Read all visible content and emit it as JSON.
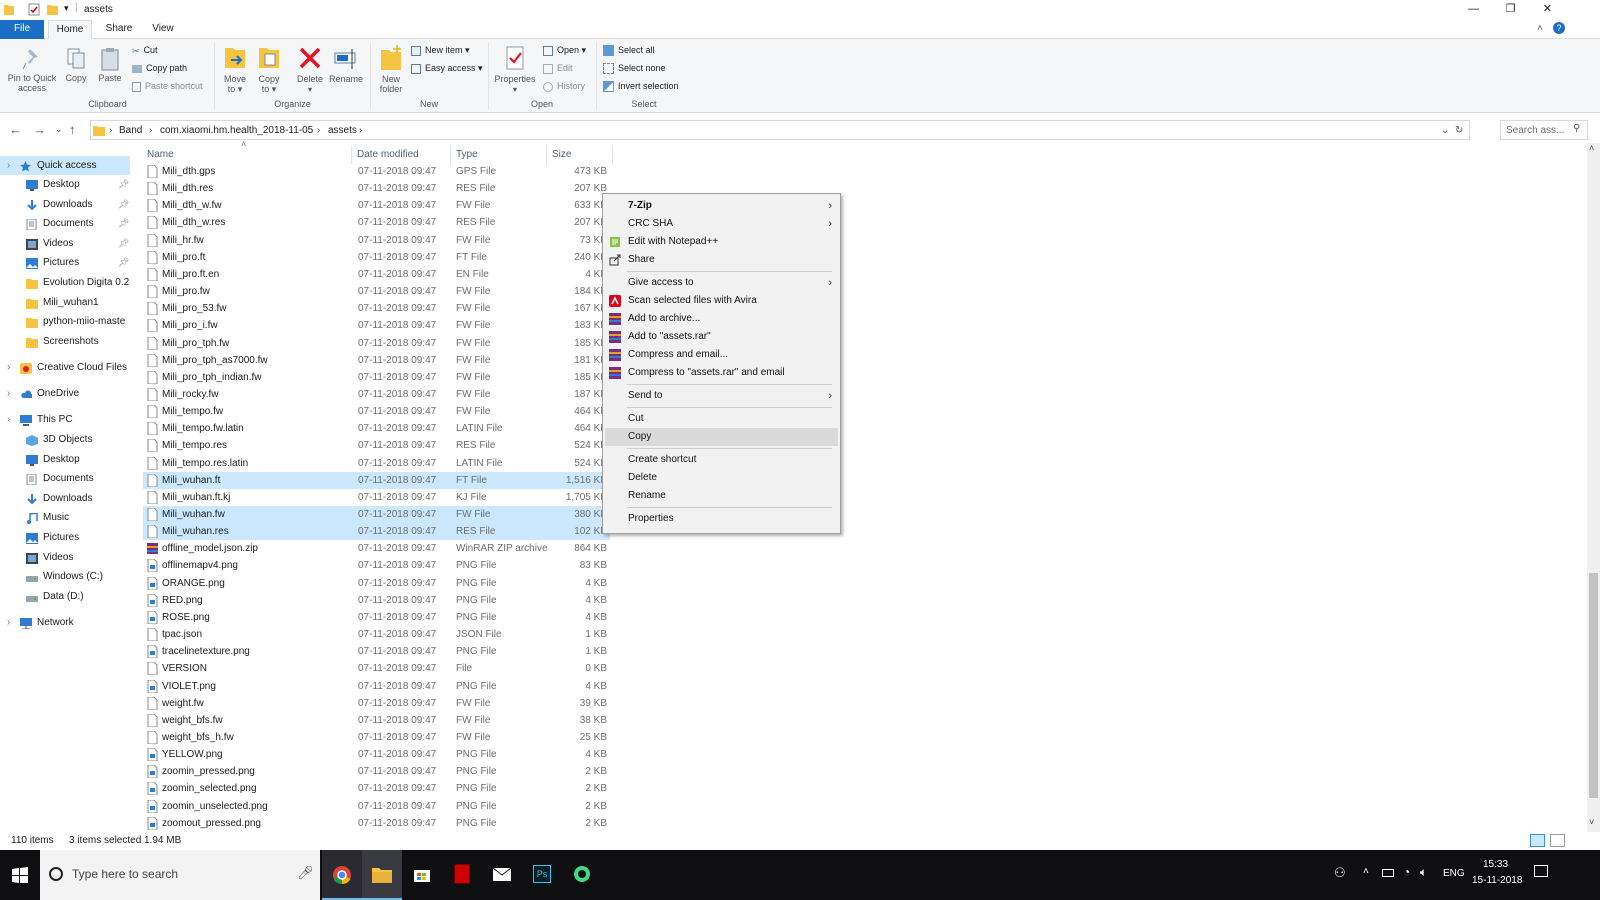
{
  "window": {
    "title": "assets"
  },
  "tabs": [
    {
      "label": "File"
    },
    {
      "label": "Home"
    },
    {
      "label": "Share"
    },
    {
      "label": "View"
    }
  ],
  "ribbon": {
    "clipboard": {
      "group": "Clipboard",
      "pin": "Pin to Quick access",
      "copy": "Copy",
      "paste": "Paste",
      "cut": "Cut",
      "copy_path": "Copy path",
      "paste_shortcut": "Paste shortcut"
    },
    "organize": {
      "group": "Organize",
      "move_to": "Move to ▾",
      "copy_to": "Copy to ▾",
      "delete": "Delete",
      "rename": "Rename"
    },
    "new": {
      "group": "New",
      "new_folder": "New folder",
      "new_item": "New item ▾",
      "easy_access": "Easy access ▾"
    },
    "open": {
      "group": "Open",
      "properties": "Properties",
      "open": "Open ▾",
      "edit": "Edit",
      "history": "History"
    },
    "select": {
      "group": "Select",
      "select_all": "Select all",
      "select_none": "Select none",
      "invert": "Invert selection"
    }
  },
  "address": {
    "crumbs": [
      "Band",
      "com.xiaomi.hm.health_2018-11-05",
      "assets"
    ],
    "search_placeholder": "Search ass..."
  },
  "nav": {
    "quick_access": "Quick access",
    "quick_items": [
      "Desktop",
      "Downloads",
      "Documents",
      "Videos",
      "Pictures",
      "Evolution Digita 0.2",
      "Mili_wuhan1",
      "python-miio-maste",
      "Screenshots"
    ],
    "creative_cloud": "Creative Cloud Files",
    "onedrive": "OneDrive",
    "this_pc": "This PC",
    "pc_items": [
      "3D Objects",
      "Desktop",
      "Documents",
      "Downloads",
      "Music",
      "Pictures",
      "Videos",
      "Windows (C:)",
      "Data (D:)"
    ],
    "network": "Network"
  },
  "columns": {
    "name": "Name",
    "date": "Date modified",
    "type": "Type",
    "size": "Size"
  },
  "files": [
    {
      "name": "Mili_dth.gps",
      "date": "07-11-2018 09:47",
      "type": "GPS File",
      "size": "473 KB"
    },
    {
      "name": "Mili_dth.res",
      "date": "07-11-2018 09:47",
      "type": "RES File",
      "size": "207 KB"
    },
    {
      "name": "Mili_dth_w.fw",
      "date": "07-11-2018 09:47",
      "type": "FW File",
      "size": "633 KB"
    },
    {
      "name": "Mili_dth_w.res",
      "date": "07-11-2018 09:47",
      "type": "RES File",
      "size": "207 KB"
    },
    {
      "name": "Mili_hr.fw",
      "date": "07-11-2018 09:47",
      "type": "FW File",
      "size": "73 KB"
    },
    {
      "name": "Mili_pro.ft",
      "date": "07-11-2018 09:47",
      "type": "FT File",
      "size": "240 KB"
    },
    {
      "name": "Mili_pro.ft.en",
      "date": "07-11-2018 09:47",
      "type": "EN File",
      "size": "4 KB"
    },
    {
      "name": "Mili_pro.fw",
      "date": "07-11-2018 09:47",
      "type": "FW File",
      "size": "184 KB"
    },
    {
      "name": "Mili_pro_53.fw",
      "date": "07-11-2018 09:47",
      "type": "FW File",
      "size": "167 KB"
    },
    {
      "name": "Mili_pro_i.fw",
      "date": "07-11-2018 09:47",
      "type": "FW File",
      "size": "183 KB"
    },
    {
      "name": "Mili_pro_tph.fw",
      "date": "07-11-2018 09:47",
      "type": "FW File",
      "size": "185 KB"
    },
    {
      "name": "Mili_pro_tph_as7000.fw",
      "date": "07-11-2018 09:47",
      "type": "FW File",
      "size": "181 KB"
    },
    {
      "name": "Mili_pro_tph_indian.fw",
      "date": "07-11-2018 09:47",
      "type": "FW File",
      "size": "185 KB"
    },
    {
      "name": "Mili_rocky.fw",
      "date": "07-11-2018 09:47",
      "type": "FW File",
      "size": "187 KB"
    },
    {
      "name": "Mili_tempo.fw",
      "date": "07-11-2018 09:47",
      "type": "FW File",
      "size": "464 KB"
    },
    {
      "name": "Mili_tempo.fw.latin",
      "date": "07-11-2018 09:47",
      "type": "LATIN File",
      "size": "464 KB"
    },
    {
      "name": "Mili_tempo.res",
      "date": "07-11-2018 09:47",
      "type": "RES File",
      "size": "524 KB"
    },
    {
      "name": "Mili_tempo.res.latin",
      "date": "07-11-2018 09:47",
      "type": "LATIN File",
      "size": "524 KB"
    },
    {
      "name": "Mili_wuhan.ft",
      "date": "07-11-2018 09:47",
      "type": "FT File",
      "size": "1,516 KB",
      "selected": true
    },
    {
      "name": "Mili_wuhan.ft.kj",
      "date": "07-11-2018 09:47",
      "type": "KJ File",
      "size": "1,705 KB"
    },
    {
      "name": "Mili_wuhan.fw",
      "date": "07-11-2018 09:47",
      "type": "FW File",
      "size": "380 KB",
      "selected": true
    },
    {
      "name": "Mili_wuhan.res",
      "date": "07-11-2018 09:47",
      "type": "RES File",
      "size": "102 KB",
      "selected": true
    },
    {
      "name": "offline_model.json.zip",
      "date": "07-11-2018 09:47",
      "type": "WinRAR ZIP archive",
      "size": "864 KB",
      "icon": "winrar"
    },
    {
      "name": "offlinemapv4.png",
      "date": "07-11-2018 09:47",
      "type": "PNG File",
      "size": "83 KB",
      "icon": "png"
    },
    {
      "name": "ORANGE.png",
      "date": "07-11-2018 09:47",
      "type": "PNG File",
      "size": "4 KB",
      "icon": "png"
    },
    {
      "name": "RED.png",
      "date": "07-11-2018 09:47",
      "type": "PNG File",
      "size": "4 KB",
      "icon": "png"
    },
    {
      "name": "ROSE.png",
      "date": "07-11-2018 09:47",
      "type": "PNG File",
      "size": "4 KB",
      "icon": "png"
    },
    {
      "name": "tpac.json",
      "date": "07-11-2018 09:47",
      "type": "JSON File",
      "size": "1 KB"
    },
    {
      "name": "tracelinetexture.png",
      "date": "07-11-2018 09:47",
      "type": "PNG File",
      "size": "1 KB",
      "icon": "png"
    },
    {
      "name": "VERSION",
      "date": "07-11-2018 09:47",
      "type": "File",
      "size": "0 KB"
    },
    {
      "name": "VIOLET.png",
      "date": "07-11-2018 09:47",
      "type": "PNG File",
      "size": "4 KB",
      "icon": "png"
    },
    {
      "name": "weight.fw",
      "date": "07-11-2018 09:47",
      "type": "FW File",
      "size": "39 KB"
    },
    {
      "name": "weight_bfs.fw",
      "date": "07-11-2018 09:47",
      "type": "FW File",
      "size": "38 KB"
    },
    {
      "name": "weight_bfs_h.fw",
      "date": "07-11-2018 09:47",
      "type": "FW File",
      "size": "25 KB"
    },
    {
      "name": "YELLOW.png",
      "date": "07-11-2018 09:47",
      "type": "PNG File",
      "size": "4 KB",
      "icon": "png"
    },
    {
      "name": "zoomin_pressed.png",
      "date": "07-11-2018 09:47",
      "type": "PNG File",
      "size": "2 KB",
      "icon": "png"
    },
    {
      "name": "zoomin_selected.png",
      "date": "07-11-2018 09:47",
      "type": "PNG File",
      "size": "2 KB",
      "icon": "png"
    },
    {
      "name": "zoomin_unselected.png",
      "date": "07-11-2018 09:47",
      "type": "PNG File",
      "size": "2 KB",
      "icon": "png"
    },
    {
      "name": "zoomout_pressed.png",
      "date": "07-11-2018 09:47",
      "type": "PNG File",
      "size": "2 KB",
      "icon": "png"
    }
  ],
  "context_menu": [
    {
      "label": "7-Zip",
      "bold": true,
      "submenu": true
    },
    {
      "label": "CRC SHA",
      "submenu": true
    },
    {
      "label": "Edit with Notepad++",
      "icon": "notepad"
    },
    {
      "label": "Share",
      "icon": "share"
    },
    {
      "sep": true
    },
    {
      "label": "Give access to",
      "submenu": true
    },
    {
      "label": "Scan selected files with Avira",
      "icon": "avira"
    },
    {
      "label": "Add to archive...",
      "icon": "winrar"
    },
    {
      "label": "Add to \"assets.rar\"",
      "icon": "winrar"
    },
    {
      "label": "Compress and email...",
      "icon": "winrar"
    },
    {
      "label": "Compress to \"assets.rar\" and email",
      "icon": "winrar"
    },
    {
      "sep": true
    },
    {
      "label": "Send to",
      "submenu": true
    },
    {
      "sep": true
    },
    {
      "label": "Cut"
    },
    {
      "label": "Copy",
      "highlighted": true
    },
    {
      "sep": true
    },
    {
      "label": "Create shortcut"
    },
    {
      "label": "Delete"
    },
    {
      "label": "Rename"
    },
    {
      "sep": true
    },
    {
      "label": "Properties"
    }
  ],
  "status": {
    "count": "110 items",
    "selected": "3 items selected  1.94 MB"
  },
  "taskbar": {
    "search_placeholder": "Type here to search",
    "lang": "ENG",
    "time": "15:33",
    "date": "15-11-2018"
  },
  "colors": {
    "accent": "#1a6ec4",
    "selection": "#cce8ff",
    "folder": "#f4c442",
    "taskbar": "#0f0f12"
  }
}
